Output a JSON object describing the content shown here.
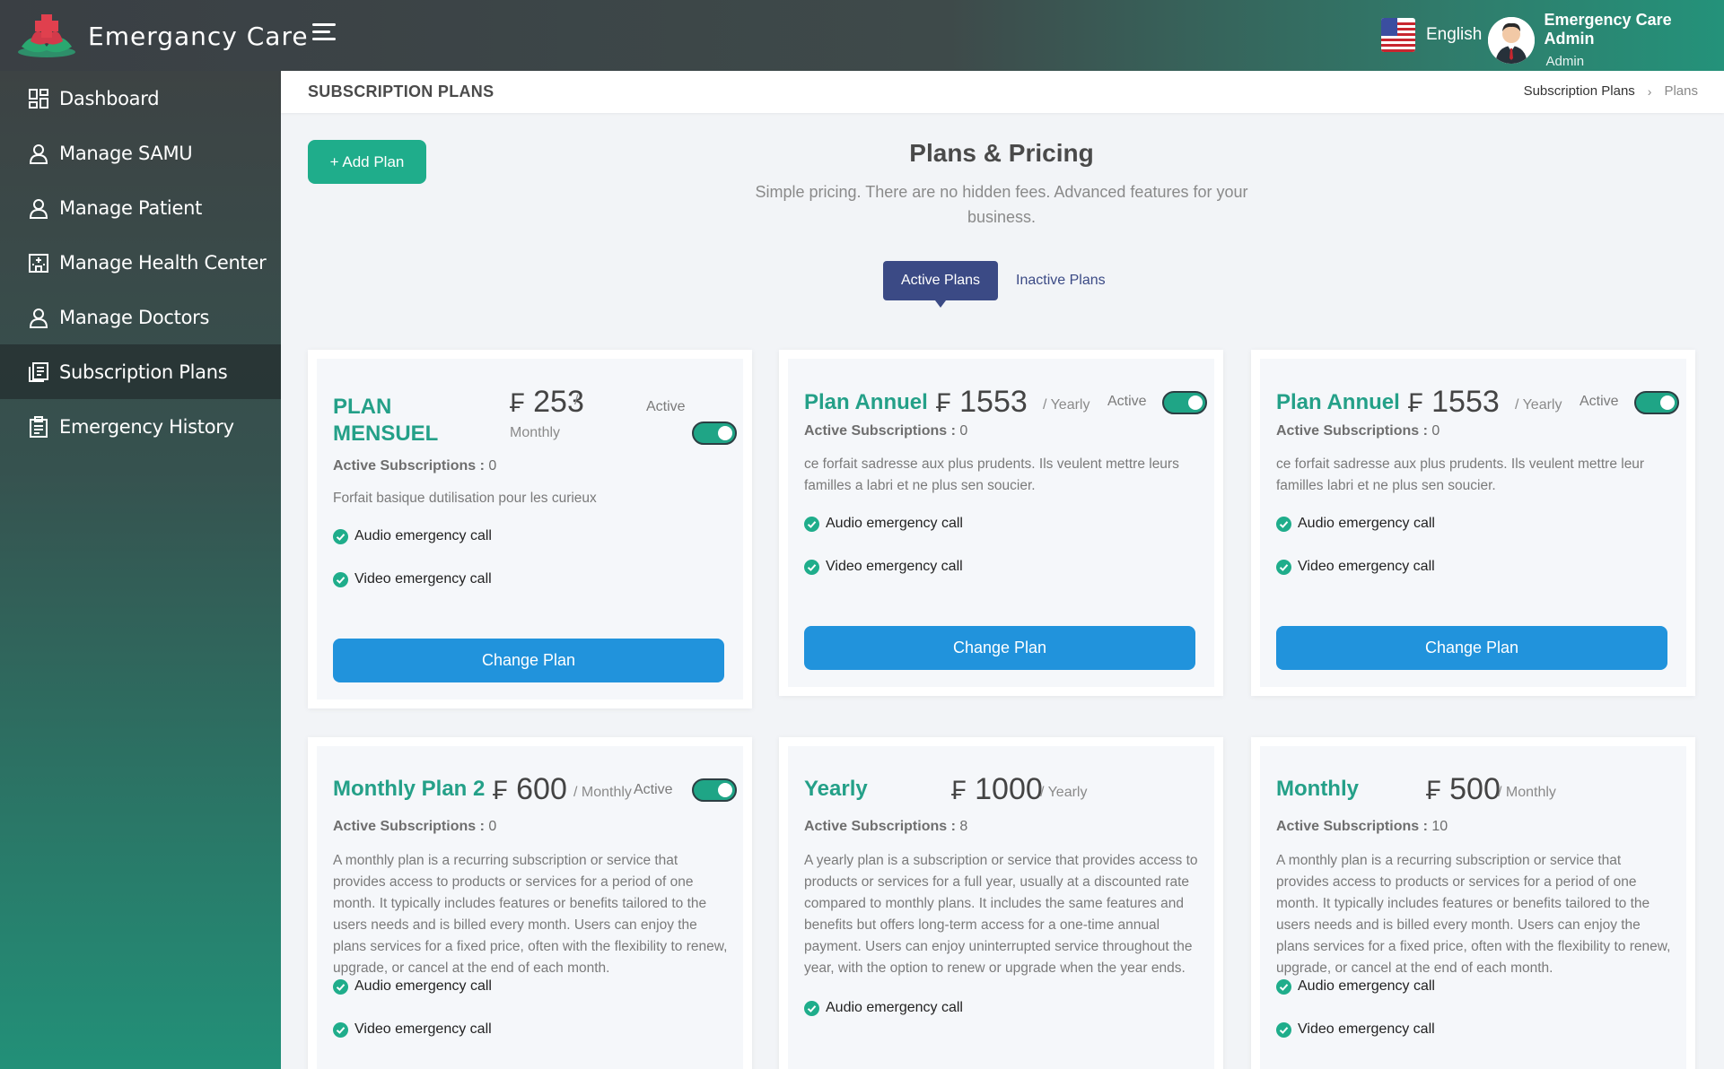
{
  "app": {
    "brand": "Emergancy Care"
  },
  "header": {
    "language": "English",
    "user_name": "Emergency Care Admin",
    "user_role": "Admin"
  },
  "sidebar": {
    "items": [
      {
        "label": "Dashboard",
        "icon": "dashboard-icon"
      },
      {
        "label": "Manage SAMU",
        "icon": "user-icon"
      },
      {
        "label": "Manage Patient",
        "icon": "user-icon"
      },
      {
        "label": "Manage Health Center",
        "icon": "hospital-icon"
      },
      {
        "label": "Manage Doctors",
        "icon": "user-icon"
      },
      {
        "label": "Subscription Plans",
        "icon": "subscription-icon",
        "active": true
      },
      {
        "label": "Emergency History",
        "icon": "clipboard-icon"
      }
    ]
  },
  "page": {
    "title": "SUBSCRIPTION PLANS",
    "breadcrumb": [
      "Subscription Plans",
      "Plans"
    ]
  },
  "content": {
    "add_plan_label": "+ Add Plan",
    "heading": "Plans & Pricing",
    "subheading": "Simple pricing. There are no hidden fees. Advanced features for your business.",
    "tabs": [
      {
        "label": "Active Plans",
        "active": true
      },
      {
        "label": "Inactive Plans",
        "active": false
      }
    ]
  },
  "labels": {
    "active_subscriptions": "Active Subscriptions :",
    "status_active": "Active",
    "change_plan": "Change Plan",
    "currency": "₣"
  },
  "plans": [
    {
      "name": "PLAN MENSUEL",
      "price": "253",
      "period": "/ Monthly",
      "status": "Active",
      "toggle_on": true,
      "active_subscriptions": "0",
      "description": "Forfait basique dutilisation pour les curieux",
      "features": [
        "Audio emergency call",
        "Video emergency call"
      ]
    },
    {
      "name": "Plan Annuel",
      "price": "1553",
      "period": "/ Yearly",
      "status": "Active",
      "toggle_on": true,
      "active_subscriptions": "0",
      "description": "ce forfait sadresse aux plus prudents. Ils veulent mettre leurs familles a labri et ne plus sen soucier.",
      "features": [
        "Audio emergency call",
        "Video emergency call"
      ]
    },
    {
      "name": "Plan Annuel",
      "price": "1553",
      "period": "/ Yearly",
      "status": "Active",
      "toggle_on": true,
      "active_subscriptions": "0",
      "description": "ce forfait sadresse aux plus prudents. Ils veulent mettre leur familles labri et ne plus sen soucier.",
      "features": [
        "Audio emergency call",
        "Video emergency call"
      ]
    },
    {
      "name": "Monthly Plan 2",
      "price": "600",
      "period": "/ Monthly",
      "status": "Active",
      "toggle_on": true,
      "active_subscriptions": "0",
      "description": "A monthly plan is a recurring subscription or service that provides access to products or services for a period of one month. It typically includes features or benefits tailored to the users needs and is billed every month. Users can enjoy the plans services for a fixed price, often with the flexibility to renew, upgrade, or cancel at the end of each month.",
      "features": [
        "Audio emergency call",
        "Video emergency call"
      ]
    },
    {
      "name": "Yearly",
      "price": "1000",
      "period": "/ Yearly",
      "active_subscriptions": "8",
      "description": "A yearly plan is a subscription or service that provides access to products or services for a full year, usually at a discounted rate compared to monthly plans. It includes the same features and benefits but offers long-term access for a one-time annual payment. Users can enjoy uninterrupted service throughout the year, with the option to renew or upgrade when the year ends.",
      "features": [
        "Audio emergency call"
      ]
    },
    {
      "name": "Monthly",
      "price": "500",
      "period": "/ Monthly",
      "active_subscriptions": "10",
      "description": "A monthly plan is a recurring subscription or service that provides access to products or services for a period of one month. It typically includes features or benefits tailored to the users needs and is billed every month. Users can enjoy the plans services for a fixed price, often with the flexibility to renew, upgrade, or cancel at the end of each month.",
      "features": [
        "Audio emergency call",
        "Video emergency call"
      ]
    }
  ],
  "colors": {
    "accent": "#1fad8b",
    "plan_name": "#24a088",
    "tab_active": "#3b4a85",
    "button_blue": "#2193dc"
  }
}
